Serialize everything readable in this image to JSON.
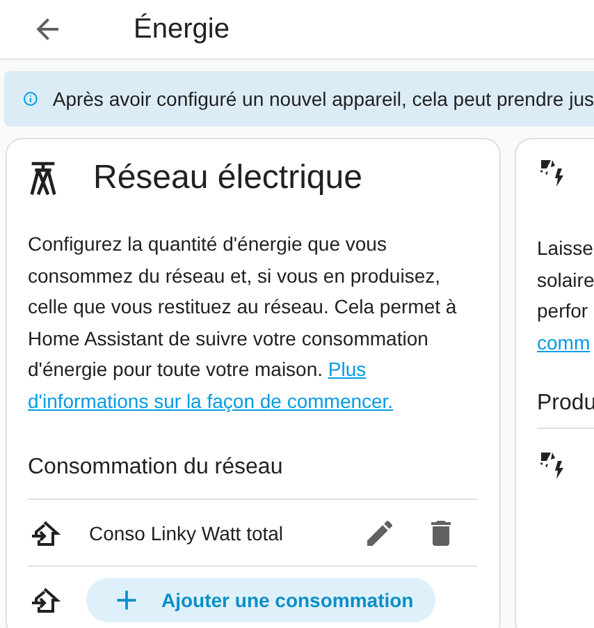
{
  "header": {
    "title": "Énergie"
  },
  "alert": {
    "text": "Après avoir configuré un nouvel appareil, cela peut prendre jus"
  },
  "grid_card": {
    "title": "Réseau électrique",
    "description": "Configurez la quantité d'énergie que vous consommez du réseau et, si vous en produisez, celle que vous restituez au réseau. Cela permet à Home Assistant de suivre votre consommation d'énergie pour toute votre maison.",
    "link_lines": [
      "Plus",
      "d'informations sur la façon de commencer."
    ],
    "section_title": "Consommation du réseau",
    "sources": [
      {
        "name": "Conso Linky Watt total"
      }
    ],
    "add_button": "Ajouter une consommation"
  },
  "solar_card": {
    "lines": [
      "Laisse",
      "solaire",
      "perfor"
    ],
    "link": "comm",
    "section_title": "Produ"
  }
}
